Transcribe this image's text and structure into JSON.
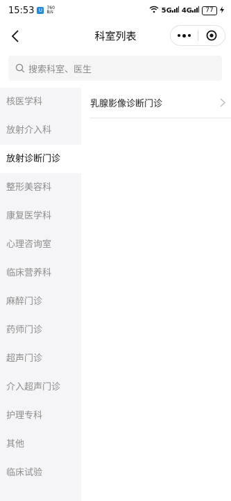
{
  "status_bar": {
    "time": "15:53",
    "app_badge": "U",
    "net_speed_value": "760",
    "net_speed_unit": "B/s",
    "signal_1": "5G",
    "signal_2": "4G",
    "battery": "77"
  },
  "nav": {
    "title": "科室列表"
  },
  "search": {
    "placeholder": "搜索科室、医生"
  },
  "sidebar": {
    "items": [
      {
        "label": "核医学科"
      },
      {
        "label": "放射介入科"
      },
      {
        "label": "放射诊断门诊"
      },
      {
        "label": "整形美容科"
      },
      {
        "label": "康复医学科"
      },
      {
        "label": "心理咨询室"
      },
      {
        "label": "临床营养科"
      },
      {
        "label": "麻醉门诊"
      },
      {
        "label": "药师门诊"
      },
      {
        "label": "超声门诊"
      },
      {
        "label": "介入超声门诊"
      },
      {
        "label": "护理专科"
      },
      {
        "label": "其他"
      },
      {
        "label": "临床试验"
      }
    ],
    "active_index": 2
  },
  "content": {
    "items": [
      {
        "label": "乳腺影像诊断门诊"
      }
    ]
  }
}
